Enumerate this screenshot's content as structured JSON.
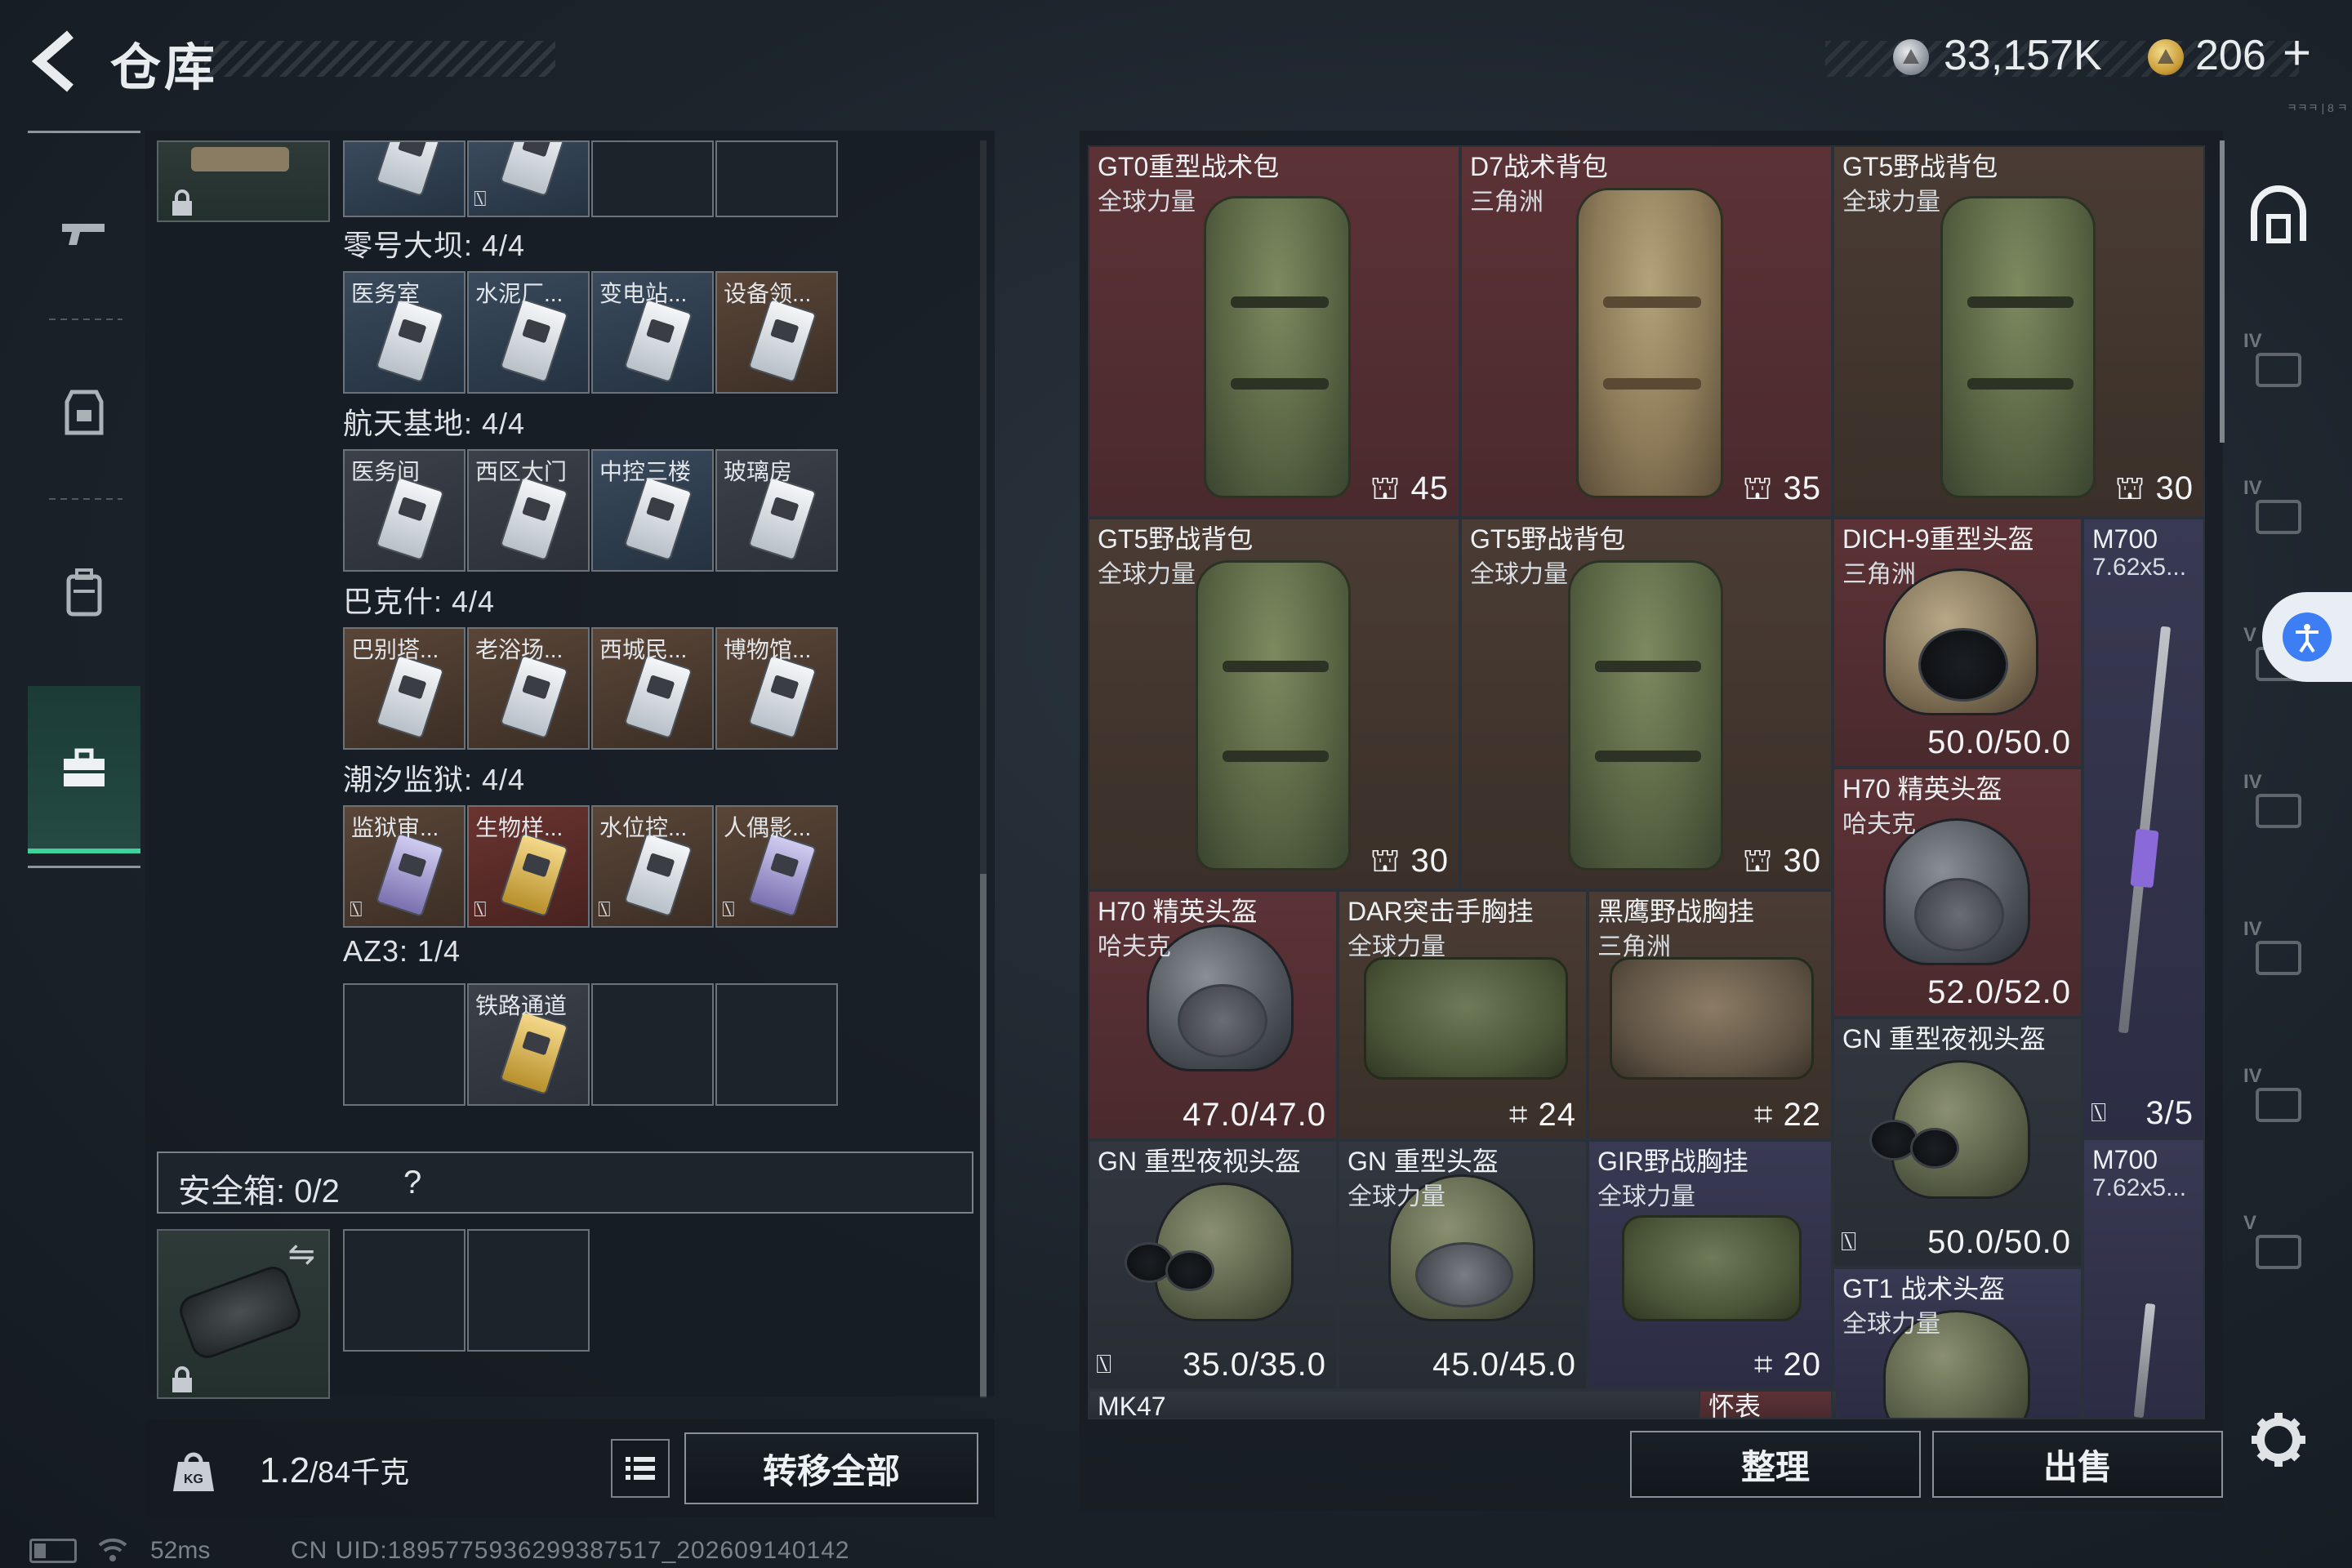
{
  "header": {
    "title": "仓库",
    "currency_silver": "33,157K",
    "currency_gold": "206",
    "plus": "+",
    "corner_text": "ㅋㅋㅋ | 8 ㅋ"
  },
  "left_panel": {
    "groups": [
      {
        "title": "零号大坝: 4/4",
        "keys": [
          "医务室",
          "水泥厂...",
          "变电站...",
          "设备领..."
        ]
      },
      {
        "title": "航天基地: 4/4",
        "keys": [
          "医务间",
          "西区大门",
          "中控三楼",
          "玻璃房"
        ]
      },
      {
        "title": "巴克什: 4/4",
        "keys": [
          "巴别塔...",
          "老浴场...",
          "西城民...",
          "博物馆..."
        ]
      },
      {
        "title": "潮汐监狱: 4/4",
        "keys": [
          "监狱审...",
          "生物样...",
          "水位控...",
          "人偶影..."
        ]
      },
      {
        "title": "AZ3: 1/4",
        "keys": [
          "铁路通道"
        ]
      }
    ],
    "safe_box_label": "安全箱: 0/2",
    "safe_box_help": "?",
    "weight_value": "1.2",
    "weight_unit": "/84千克",
    "transfer_all": "转移全部"
  },
  "items": [
    {
      "name": "GT0重型战术包",
      "sub": "全球力量",
      "value": "45"
    },
    {
      "name": "D7战术背包",
      "sub": "三角洲",
      "value": "35"
    },
    {
      "name": "GT5野战背包",
      "sub": "全球力量",
      "value": "30"
    },
    {
      "name": "GT5野战背包",
      "sub": "全球力量",
      "value": "30"
    },
    {
      "name": "GT5野战背包",
      "sub": "全球力量",
      "value": "30"
    },
    {
      "name": "DICH-9重型头盔",
      "sub": "三角洲",
      "value": "50.0/50.0"
    },
    {
      "name": "M700",
      "sub": "7.62x5...",
      "value": "3/5"
    },
    {
      "name": "H70 精英头盔",
      "sub": "哈夫克",
      "value": "52.0/52.0"
    },
    {
      "name": "H70 精英头盔",
      "sub": "哈夫克",
      "value": "47.0/47.0"
    },
    {
      "name": "DAR突击手胸挂",
      "sub": "全球力量",
      "value": "24"
    },
    {
      "name": "黑鹰野战胸挂",
      "sub": "三角洲",
      "value": "22"
    },
    {
      "name": "GN 重型夜视头盔",
      "sub": "",
      "value": "50.0/50.0"
    },
    {
      "name": "GN 重型夜视头盔",
      "sub": "",
      "value": "35.0/35.0"
    },
    {
      "name": "GN 重型头盔",
      "sub": "全球力量",
      "value": "45.0/45.0"
    },
    {
      "name": "GIR野战胸挂",
      "sub": "全球力量",
      "value": "20"
    },
    {
      "name": "M700",
      "sub": "7.62x5...",
      "value": ""
    },
    {
      "name": "GT1 战术头盔",
      "sub": "全球力量",
      "value": ""
    },
    {
      "name": "MK47",
      "sub": "",
      "value": ""
    },
    {
      "name": "怀表",
      "sub": "",
      "value": ""
    }
  ],
  "right_rail": {
    "tiers": [
      "IV",
      "IV",
      "V",
      "IV",
      "IV",
      "IV",
      "V"
    ]
  },
  "actions": {
    "organize": "整理",
    "sell": "出售"
  },
  "status": {
    "ping": "52ms",
    "uid": "CN UID:1895775936299387517_202609140142"
  },
  "colors": {
    "accent_green": "#3fd39c",
    "item_red": "#5c3236",
    "item_brown": "#4a3c34",
    "item_gray": "#32373f",
    "item_purple": "#383952"
  }
}
